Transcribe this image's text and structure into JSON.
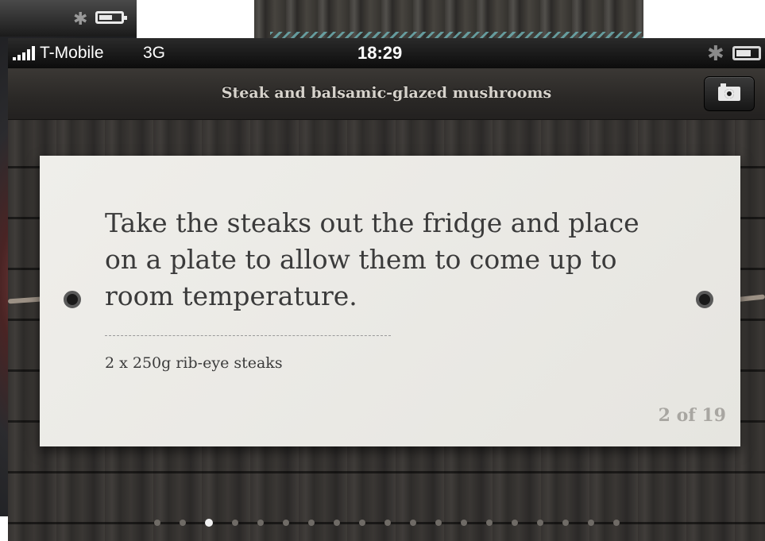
{
  "background_app": {
    "status": {
      "bluetooth_icon": "bluetooth-icon",
      "battery_icon": "battery-icon"
    }
  },
  "status_bar": {
    "carrier": "T-Mobile",
    "network": "3G",
    "time": "18:29"
  },
  "nav": {
    "title": "Steak and balsamic-glazed mushrooms",
    "camera_icon": "camera-icon"
  },
  "card": {
    "instruction": "Take the steaks out the fridge and place on a plate to allow them to come up to room temperature.",
    "ingredient": "2 x 250g rib-eye steaks",
    "step_counter": "2 of 19"
  },
  "pager": {
    "total_dots": 19,
    "active_index": 2
  },
  "colors": {
    "card": "#ece9e4",
    "wood": "#35322f",
    "text": "#3b3b3b"
  }
}
